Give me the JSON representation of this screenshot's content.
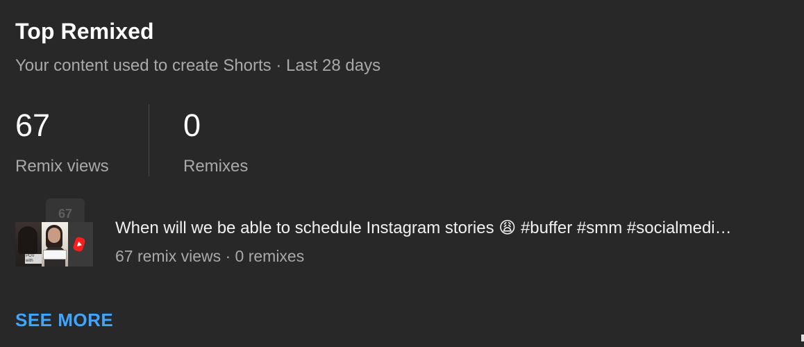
{
  "card": {
    "title": "Top Remixed",
    "subtitle": "Your content used to create Shorts · Last 28 days"
  },
  "metrics": [
    {
      "value": "67",
      "label": "Remix views"
    },
    {
      "value": "0",
      "label": "Remixes"
    }
  ],
  "top_video": {
    "thumb_badge": "67",
    "thumb_caption": "POV with",
    "title": "When will we be able to schedule Instagram stories 😩 #buffer #smm #socialmedi…",
    "meta": "67 remix views · 0 remixes"
  },
  "actions": {
    "see_more": "SEE MORE"
  },
  "colors": {
    "background": "#282828",
    "primary_text": "#f1f1f1",
    "secondary_text": "#a9a9a9",
    "link": "#3ea6ff",
    "shorts_red": "#ff1c1c"
  },
  "icons": {
    "shorts": "shorts-logo-icon"
  }
}
